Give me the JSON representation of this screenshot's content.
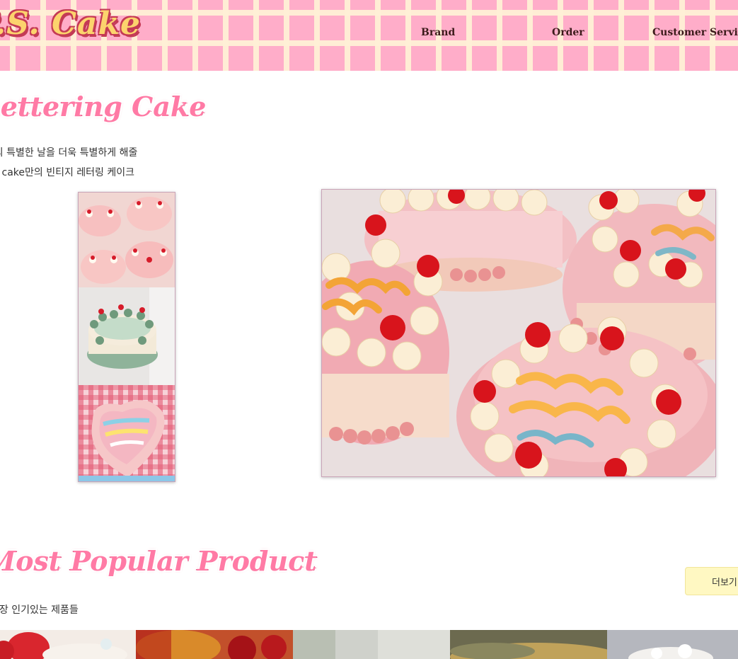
{
  "header": {
    "logo": "P.S. Cake",
    "nav": [
      {
        "label": "Brand"
      },
      {
        "label": "Order"
      },
      {
        "label": "Customer Service"
      }
    ]
  },
  "lettering": {
    "title": "Lettering Cake",
    "desc_line1": "당신의 특별한 날을 더욱 특별하게 해줄",
    "desc_line2": "P.S. cake만의 빈티지 레터링 케이크"
  },
  "popular": {
    "title": "Most Popular Product",
    "subtitle": "가장 인기있는 제품들",
    "more_label": "더보기"
  },
  "colors": {
    "accent_pink": "#ff7aa5",
    "header_pink": "#ffadc9",
    "logo_yellow": "#fcd36d",
    "button_yellow": "#fff8c2"
  },
  "icons": {
    "thumb1": "cakes-top-view-photo",
    "thumb2": "green-heart-cake-photo",
    "thumb3": "rainbow-heart-cake-photo",
    "main": "birthday-cakes-photo"
  }
}
